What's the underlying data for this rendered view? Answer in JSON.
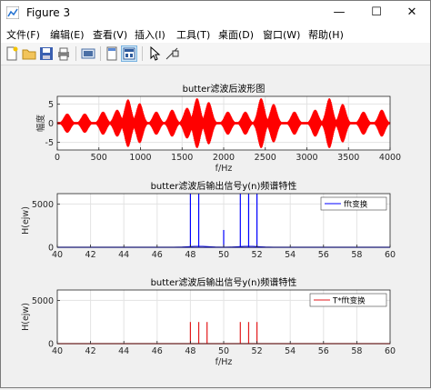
{
  "window": {
    "title": "Figure 3"
  },
  "window_controls": {
    "minimize": "—",
    "maximize": "☐",
    "close": "✕"
  },
  "menu": [
    {
      "label": "文件(F)"
    },
    {
      "label": "编辑(E)"
    },
    {
      "label": "查看(V)"
    },
    {
      "label": "插入(I)"
    },
    {
      "label": "工具(T)"
    },
    {
      "label": "桌面(D)"
    },
    {
      "label": "窗口(W)"
    },
    {
      "label": "帮助(H)"
    }
  ],
  "toolbar_icons": [
    "new-figure-icon",
    "open-file-icon",
    "save-icon",
    "print-icon",
    "link-icon",
    "dock-icon",
    "property-editor-icon",
    "pointer-icon",
    "data-cursor-icon"
  ],
  "colors": {
    "top_signal": "#ff0000",
    "middle_signal": "#0000ff",
    "bottom_signal": "#e31a1c"
  },
  "chart_data": [
    {
      "type": "line",
      "title": "butter滤波后波形图",
      "xlabel": "f/Hz",
      "ylabel": "幅度",
      "xlim": [
        0,
        4000
      ],
      "ylim": [
        -7,
        7
      ],
      "xticks": [
        0,
        500,
        1000,
        1500,
        2000,
        2500,
        3000,
        3500,
        4000
      ],
      "yticks": [
        -5,
        0,
        5
      ],
      "grid": true,
      "series": [
        {
          "envelope_peaks": [
            {
              "x": 120,
              "y": 2.5
            },
            {
              "x": 330,
              "y": 2.5
            },
            {
              "x": 550,
              "y": 3
            },
            {
              "x": 720,
              "y": 3.5
            },
            {
              "x": 850,
              "y": 6.2
            },
            {
              "x": 990,
              "y": 5.2
            },
            {
              "x": 1190,
              "y": 3
            },
            {
              "x": 1380,
              "y": 3.5
            },
            {
              "x": 1560,
              "y": 4
            },
            {
              "x": 1680,
              "y": 6.5
            },
            {
              "x": 1820,
              "y": 5.5
            },
            {
              "x": 2050,
              "y": 3
            },
            {
              "x": 2260,
              "y": 3
            },
            {
              "x": 2450,
              "y": 6.5
            },
            {
              "x": 2600,
              "y": 5
            },
            {
              "x": 2850,
              "y": 3
            },
            {
              "x": 3100,
              "y": 3.5
            },
            {
              "x": 3270,
              "y": 6.5
            },
            {
              "x": 3430,
              "y": 5
            },
            {
              "x": 3680,
              "y": 3
            },
            {
              "x": 3900,
              "y": 3.5
            }
          ]
        }
      ]
    },
    {
      "type": "line",
      "title": "butter滤波后输出信号y(n)频谱特性",
      "xlabel": "",
      "ylabel": "H(ejw)",
      "xlim": [
        40,
        60
      ],
      "ylim": [
        0,
        6200
      ],
      "xticks": [
        40,
        42,
        44,
        46,
        48,
        50,
        52,
        54,
        56,
        58,
        60
      ],
      "yticks": [
        0,
        5000
      ],
      "grid": true,
      "legend": {
        "label": "fft变换",
        "position": "top-right"
      },
      "series": [
        {
          "name": "fft变换",
          "x": [
            48,
            48.5,
            50,
            51,
            51.5,
            52
          ],
          "y": [
            6200,
            6200,
            2000,
            6200,
            6200,
            6200
          ]
        }
      ]
    },
    {
      "type": "line",
      "title": "butter滤波后输出信号y(n)频谱特性",
      "xlabel": "f/Hz",
      "ylabel": "H(ejw)",
      "xlim": [
        40,
        60
      ],
      "ylim": [
        0,
        6200
      ],
      "xticks": [
        40,
        42,
        44,
        46,
        48,
        50,
        52,
        54,
        56,
        58,
        60
      ],
      "yticks": [
        0,
        5000
      ],
      "grid": true,
      "legend": {
        "label": "T*fft变换",
        "position": "top-right"
      },
      "series": [
        {
          "name": "T*fft变换",
          "x": [
            48,
            48.5,
            49,
            51,
            51.5,
            52
          ],
          "y": [
            2500,
            2500,
            2500,
            2500,
            2500,
            2500
          ]
        }
      ]
    }
  ]
}
